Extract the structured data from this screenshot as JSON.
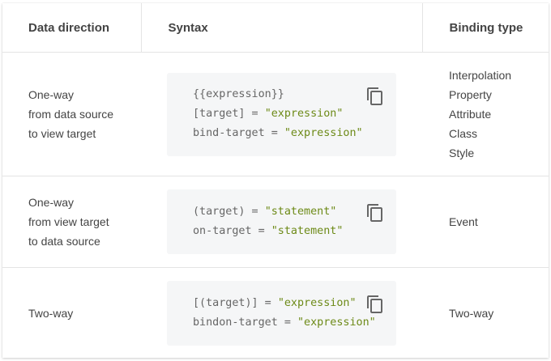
{
  "table": {
    "headers": [
      "Data direction",
      "Syntax",
      "Binding type"
    ],
    "rows": [
      {
        "direction": [
          "One-way",
          "from data source",
          "to view target"
        ],
        "syntax": [
          {
            "plain": "{{expression}}",
            "str": ""
          },
          {
            "plain": "[target] = ",
            "str": "\"expression\""
          },
          {
            "plain": "bind-target = ",
            "str": "\"expression\""
          }
        ],
        "binding_types": [
          "Interpolation",
          "Property",
          "Attribute",
          "Class",
          "Style"
        ]
      },
      {
        "direction": [
          "One-way",
          "from view target",
          "to data source"
        ],
        "syntax": [
          {
            "plain": "(target) = ",
            "str": "\"statement\""
          },
          {
            "plain": "on-target = ",
            "str": "\"statement\""
          }
        ],
        "binding_types": [
          "Event"
        ]
      },
      {
        "direction": [
          "Two-way"
        ],
        "syntax": [
          {
            "plain": "[(target)] = ",
            "str": "\"expression\""
          },
          {
            "plain": "bindon-target = ",
            "str": "\"expression\""
          }
        ],
        "binding_types": [
          "Two-way"
        ]
      }
    ]
  },
  "icons": {
    "copy": "content-copy-icon"
  },
  "colors": {
    "header_text": "#444444",
    "code_background": "#f5f6f7",
    "code_string": "#6d8a17",
    "code_text": "#666666",
    "border": "#e4e4e4"
  }
}
